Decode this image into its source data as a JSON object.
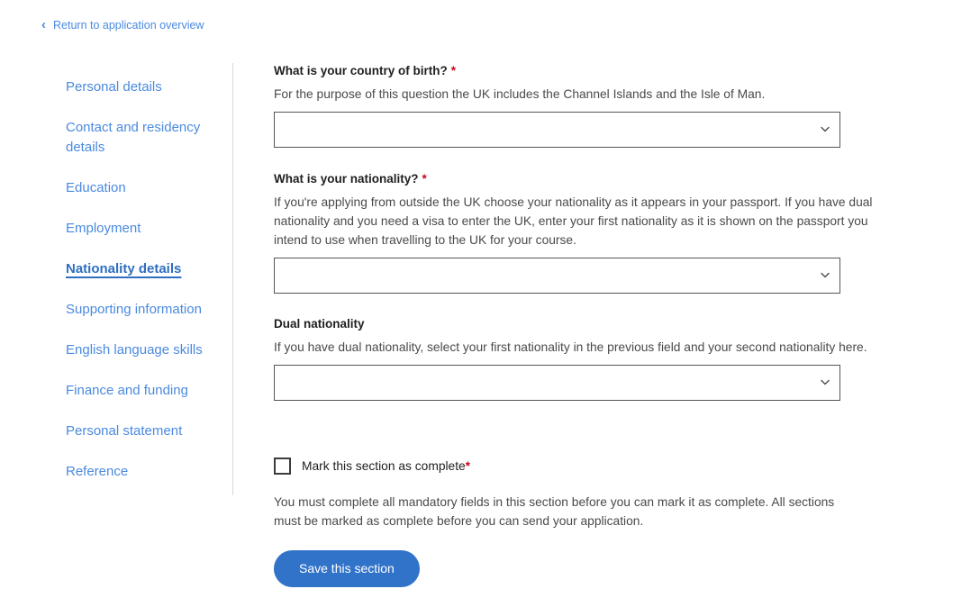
{
  "back_link": {
    "icon": "chevron-left-icon",
    "label": "Return to application overview"
  },
  "sidebar": {
    "items": [
      {
        "label": "Personal details",
        "active": false
      },
      {
        "label": "Contact and residency details",
        "active": false
      },
      {
        "label": "Education",
        "active": false
      },
      {
        "label": "Employment",
        "active": false
      },
      {
        "label": "Nationality details",
        "active": true
      },
      {
        "label": "Supporting information",
        "active": false
      },
      {
        "label": "English language skills",
        "active": false
      },
      {
        "label": "Finance and funding",
        "active": false
      },
      {
        "label": "Personal statement",
        "active": false
      },
      {
        "label": "Reference",
        "active": false
      }
    ]
  },
  "form": {
    "required_marker": "*",
    "fields": [
      {
        "label": "What is your country of birth?",
        "required": true,
        "hint": "For the purpose of this question the UK includes the Channel Islands and the Isle of Man.",
        "value": "",
        "icon": "chevron-down-icon"
      },
      {
        "label": "What is your nationality?",
        "required": true,
        "hint": "If you're applying from outside the UK choose your nationality as it appears in your passport. If you have dual nationality and you need a visa to enter the UK, enter your first nationality as it is shown on the passport you intend to use when travelling to the UK for your course.",
        "value": "",
        "icon": "chevron-down-icon"
      },
      {
        "label": "Dual nationality",
        "required": false,
        "hint": "If you have dual nationality, select your first nationality in the previous field and your second nationality here.",
        "value": "",
        "icon": "chevron-down-icon"
      }
    ],
    "complete_checkbox": {
      "label": "Mark this section as complete",
      "required_marker": "*",
      "checked": false
    },
    "complete_note": "You must complete all mandatory fields in this section before you can mark it as complete. All sections must be marked as complete before you can send your application.",
    "save_button": "Save this section"
  },
  "colors": {
    "link": "#4a8ae0",
    "link_active": "#2f6fc0",
    "required": "#d0021b",
    "button": "#3273ca",
    "text": "#4a4a4a",
    "heading": "#1f1f1f",
    "border": "#565656"
  }
}
